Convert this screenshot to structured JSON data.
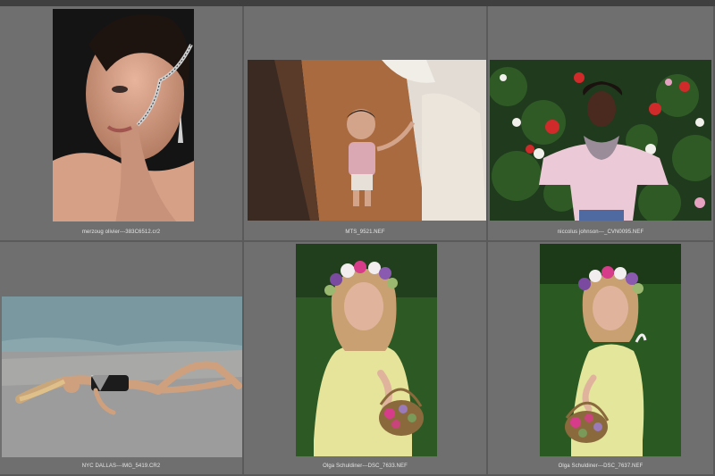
{
  "grid": {
    "cells": [
      {
        "filename": "merzoug olivier---383C6512.cr2"
      },
      {
        "filename": "MTS_9521.NEF"
      },
      {
        "filename": "niccolus johnson---_CVN0095.NEF"
      },
      {
        "filename": "NYC DALLAS---IMG_5419.CR2"
      },
      {
        "filename": "Olga Schuldiner---DSC_7633.NEF"
      },
      {
        "filename": "Olga Schuldiner---DSC_7637.NEF"
      }
    ]
  },
  "colors": {
    "background": "#5a5a5a",
    "cell": "#6f6f6f",
    "caption_text": "#e6e6e6"
  }
}
